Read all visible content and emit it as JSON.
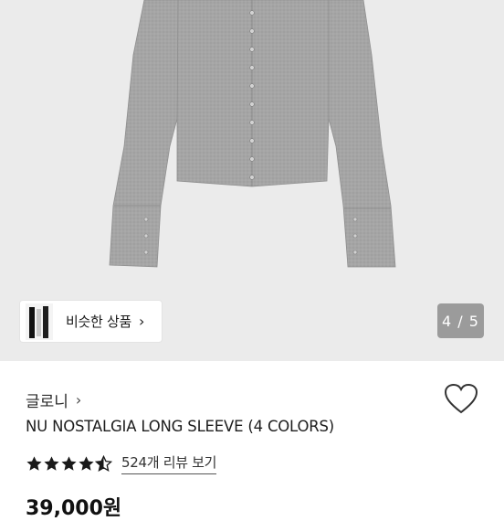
{
  "gallery": {
    "similar_products_label": "비슷한 상품",
    "page_indicator": "4 / 5",
    "current_page": 4,
    "total_pages": 5
  },
  "product": {
    "brand": "글로니",
    "title": "NU NOSTALGIA LONG SLEEVE (4 COLORS)",
    "rating": 4.5,
    "review_link": "524개 리뷰 보기",
    "price": "39,000원"
  },
  "icons": {
    "brand_chevron": "chevron-right-icon",
    "similar_chevron": "chevron-right-icon",
    "wishlist": "heart-outline-icon",
    "rating": "star-icon"
  },
  "colors": {
    "gallery_bg": "#ebebeb",
    "garment": "#a3a3a3",
    "indicator_bg": "#9b9b9b",
    "star": "#1a1a1a"
  }
}
